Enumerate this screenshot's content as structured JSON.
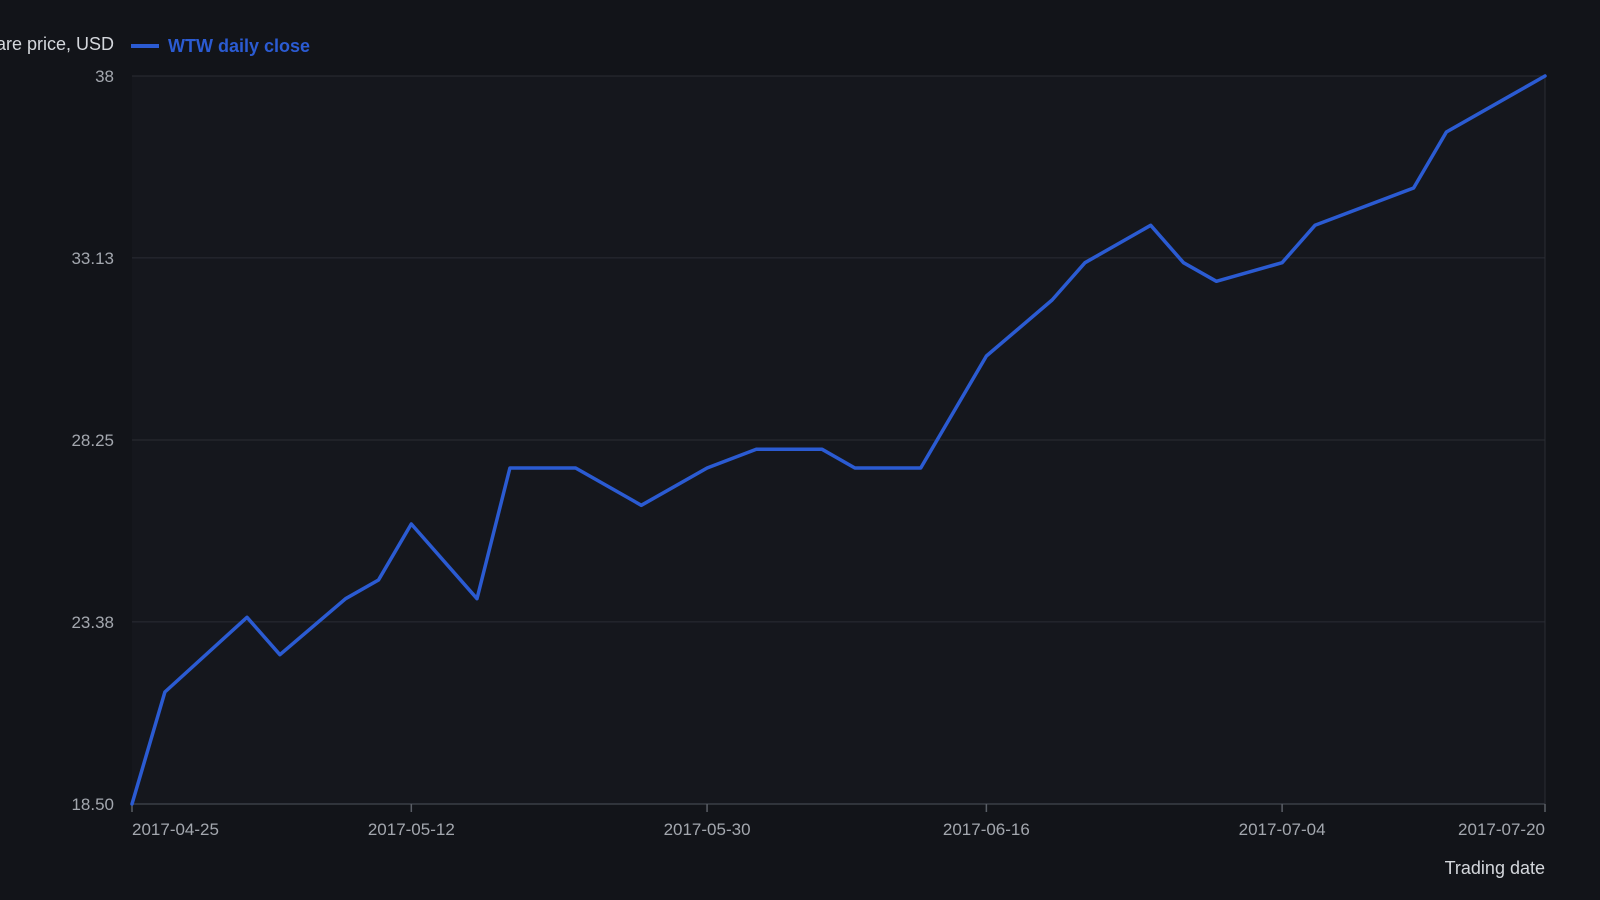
{
  "chart_data": {
    "type": "line",
    "title": "",
    "xlabel": "Trading date",
    "ylabel": "Share price, USD",
    "ylim": [
      18.5,
      38
    ],
    "yticks": [
      "18.50",
      "23.38",
      "28.25",
      "33.13",
      "38"
    ],
    "xlim": [
      "2017-04-25",
      "2017-07-20"
    ],
    "xticks": [
      "2017-04-25",
      "2017-05-12",
      "2017-05-30",
      "2017-06-16",
      "2017-07-04",
      "2017-07-20"
    ],
    "grid": true,
    "legend": "top-left",
    "colors": {
      "background": "#121419",
      "plot_background": "#15171d",
      "series": "#2b5bd2",
      "grid": "#2a2d34",
      "tick_text": "#a3a7ae",
      "axis_title_text": "#d4d7dc"
    },
    "series": [
      {
        "name": "WTW daily close",
        "x": [
          "2017-04-25",
          "2017-04-27",
          "2017-05-02",
          "2017-05-04",
          "2017-05-08",
          "2017-05-10",
          "2017-05-12",
          "2017-05-16",
          "2017-05-18",
          "2017-05-22",
          "2017-05-26",
          "2017-05-30",
          "2017-06-02",
          "2017-06-06",
          "2017-06-08",
          "2017-06-12",
          "2017-06-16",
          "2017-06-20",
          "2017-06-22",
          "2017-06-26",
          "2017-06-28",
          "2017-06-30",
          "2017-07-04",
          "2017-07-06",
          "2017-07-12",
          "2017-07-14",
          "2017-07-18",
          "2017-07-20"
        ],
        "values": [
          18.5,
          21.5,
          23.5,
          22.5,
          24.0,
          24.5,
          26.0,
          24.0,
          27.5,
          27.5,
          26.5,
          27.5,
          28.0,
          28.0,
          27.5,
          27.5,
          30.5,
          32.0,
          33.0,
          34.0,
          33.0,
          32.5,
          33.0,
          34.0,
          35.0,
          36.5,
          37.5,
          38.0
        ]
      }
    ]
  }
}
